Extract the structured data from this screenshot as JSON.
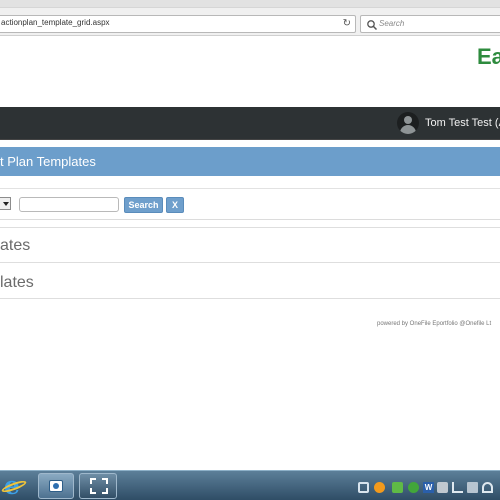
{
  "browser": {
    "url": "actionplan_template_grid.aspx",
    "search_placeholder": "Search",
    "reload_glyph": "↻"
  },
  "header": {
    "logo_text": "Ea",
    "user_name": "Tom Test Test (As"
  },
  "page": {
    "title": "t Plan Templates"
  },
  "filter": {
    "search_label": "Search",
    "clear_label": "X"
  },
  "sections": [
    {
      "heading": "ates"
    },
    {
      "heading": "lates"
    }
  ],
  "footer": {
    "powered_by": "powered by OneFile Eportfolio @Onefile Lt"
  },
  "taskbar": {
    "ie_glyph": "e",
    "tray_word_glyph": "W"
  },
  "colors": {
    "title_band": "#6c9ecb",
    "header_dark": "#2d3234",
    "brand_green": "#2e8b3e",
    "button_blue": "#6f9fcc"
  },
  "icons": [
    "reload-icon",
    "search-icon",
    "user-avatar-icon",
    "dropdown-arrow-icon",
    "internet-explorer-icon",
    "snipping-tool-icon",
    "screen-recorder-icon"
  ]
}
